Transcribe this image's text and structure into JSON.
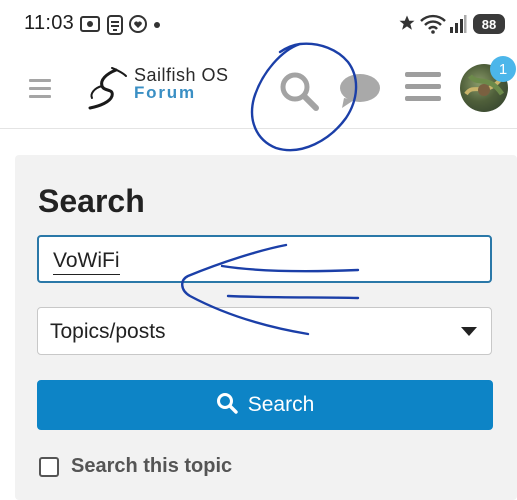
{
  "status_bar": {
    "time": "11:03",
    "battery": "88",
    "icons": [
      "screen-record-icon",
      "app-icon",
      "heart-rate-icon",
      "notification-dot-icon",
      "star-icon",
      "wifi-icon",
      "signal-icon",
      "battery-icon"
    ]
  },
  "header": {
    "brand_name": "Sailfish OS",
    "brand_sub": "Forum",
    "notification_count": "1",
    "icons": [
      "hamburger-menu-icon",
      "sailfish-logo",
      "search-icon",
      "chat-icon",
      "menu-icon",
      "avatar"
    ]
  },
  "search_panel": {
    "title": "Search",
    "input_value": "VoWiFi",
    "scope_selected": "Topics/posts",
    "search_button_label": "Search",
    "checkbox_label": "Search this topic",
    "checkbox_checked": false
  },
  "colors": {
    "accent": "#0d84c6",
    "brand_blue": "#3a8fc4",
    "badge": "#4cb6ea",
    "annotation_ink": "#1b3fa8"
  }
}
